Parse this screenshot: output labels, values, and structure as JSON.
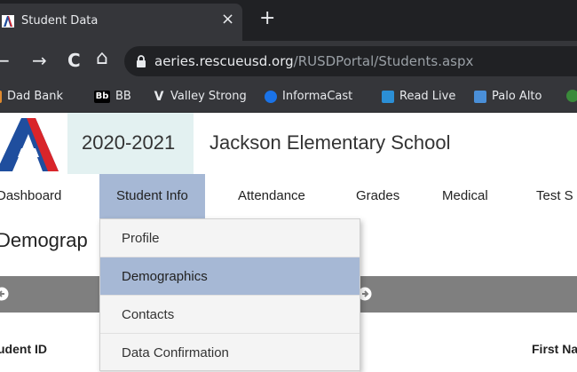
{
  "browser": {
    "tab_title": "Student Data",
    "close_glyph": "×",
    "new_tab_glyph": "+",
    "back_glyph": "←",
    "forward_glyph": "→",
    "reload_glyph": "C",
    "home_glyph": "⌂",
    "url_host": "aeries.rescueusd.org",
    "url_path": "/RUSDPortal/Students.aspx"
  },
  "bookmarks": [
    {
      "label": "Dad Bank",
      "icon": "bank-icon",
      "glyph": "",
      "color": "#e08a2e"
    },
    {
      "label": "BB",
      "icon": "blackboard-icon",
      "glyph": "Bb",
      "color": "#000000"
    },
    {
      "label": "Valley Strong",
      "icon": "valley-strong-icon",
      "glyph": "V",
      "color": "#35363a"
    },
    {
      "label": "InformaCast",
      "icon": "informacast-icon",
      "glyph": "",
      "color": "#1a73e8"
    },
    {
      "label": "Read Live",
      "icon": "read-live-icon",
      "glyph": "",
      "color": "#2b8fd6"
    },
    {
      "label": "Palo Alto",
      "icon": "palo-alto-icon",
      "glyph": "",
      "color": "#4a8fd8"
    }
  ],
  "header": {
    "school_year": "2020-2021",
    "school_name": "Jackson Elementary School"
  },
  "mainnav": {
    "items": [
      "Dashboard",
      "Student Info",
      "Attendance",
      "Grades",
      "Medical",
      "Test S"
    ],
    "active": "Student Info"
  },
  "dropdown": {
    "items": [
      "Profile",
      "Demographics",
      "Contacts",
      "Data Confirmation"
    ],
    "active": "Demographics"
  },
  "page": {
    "title": "Demograp",
    "col_student_id": "udent ID",
    "col_first_name": "First Na"
  },
  "colors": {
    "accent_active": "#a6b8d5",
    "year_box": "#e3f1f1",
    "logo_blue": "#1f4e9e",
    "logo_red": "#d9252a",
    "gray_bar": "#7f7f7f"
  }
}
